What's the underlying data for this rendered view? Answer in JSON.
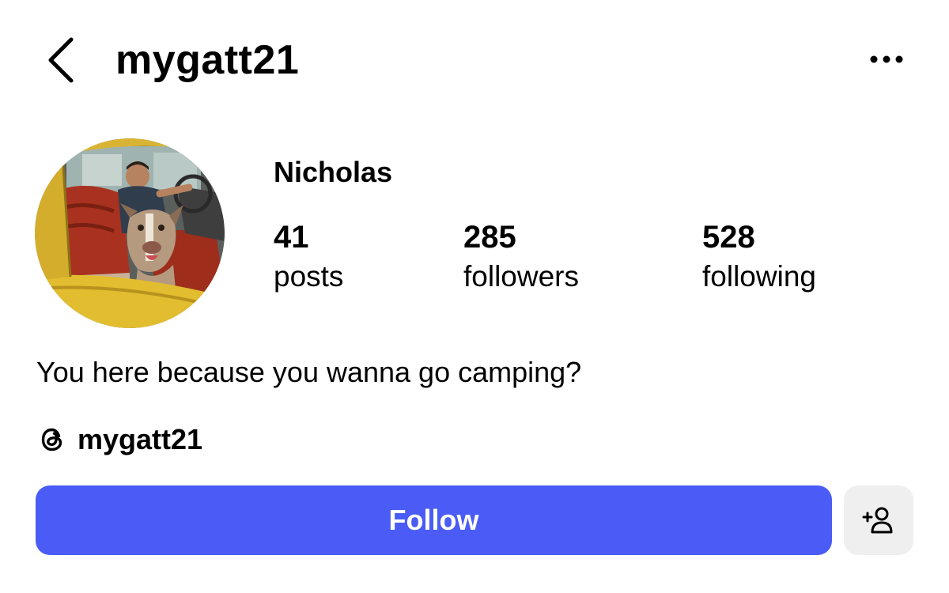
{
  "header": {
    "username": "mygatt21",
    "back_icon": "chevron-left-icon",
    "more_icon": "more-horizontal-icon"
  },
  "profile": {
    "display_name": "Nicholas",
    "avatar_description": "profile-photo",
    "stats": [
      {
        "value": "41",
        "label": "posts"
      },
      {
        "value": "285",
        "label": "followers"
      },
      {
        "value": "528",
        "label": "following"
      }
    ],
    "bio": "You here because you wanna go camping?",
    "threads": {
      "icon": "threads-icon",
      "handle": "mygatt21"
    }
  },
  "actions": {
    "follow_label": "Follow",
    "suggest_icon": "add-user-icon"
  },
  "colors": {
    "accent": "#4a5cf5",
    "secondary_button": "#efefef"
  }
}
